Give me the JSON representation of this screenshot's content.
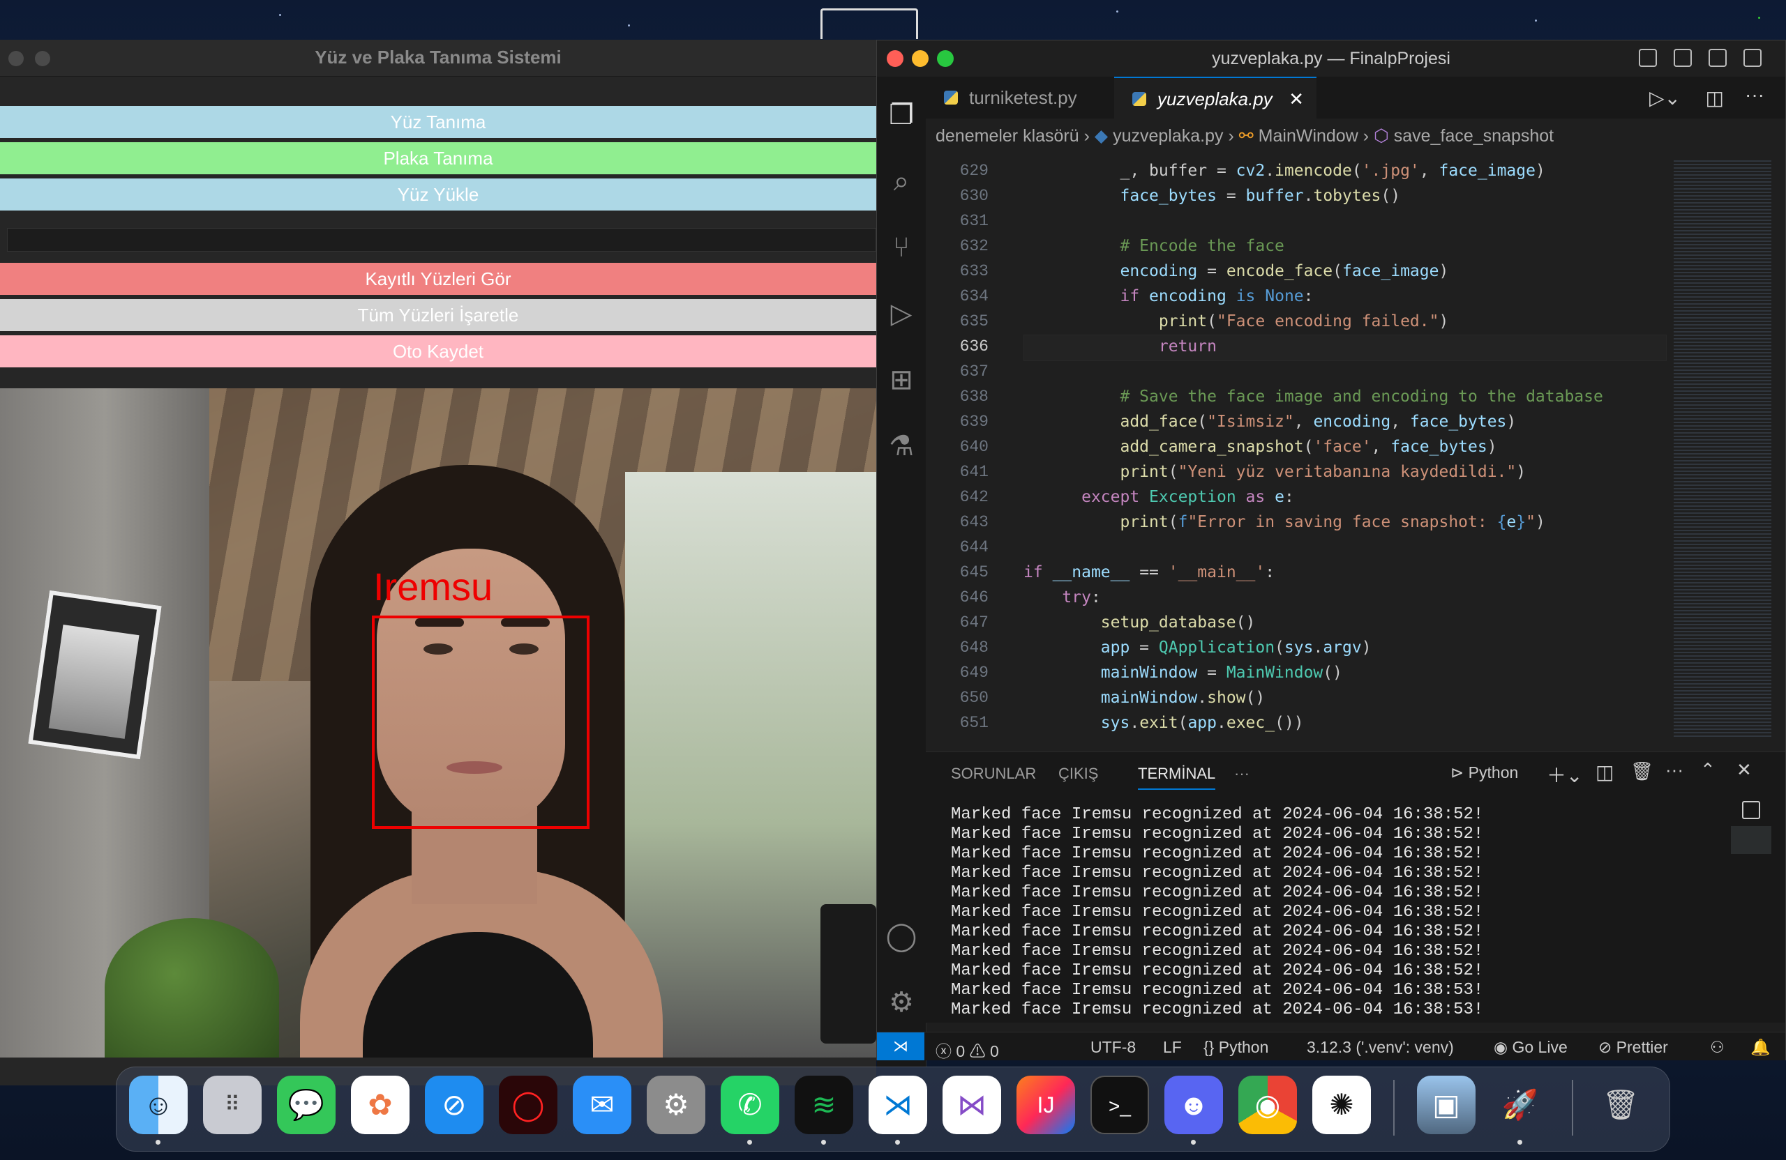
{
  "left_app": {
    "title": "Yüz ve Plaka Tanıma Sistemi",
    "buttons": {
      "face_recognition": "Yüz Tanıma",
      "plate_recognition": "Plaka Tanıma",
      "upload_face": "Yüz Yükle",
      "view_saved": "Kayıtlı Yüzleri Gör",
      "mark_all": "Tüm Yüzleri İşaretle",
      "auto_save": "Oto Kaydet"
    },
    "detected_name": "Iremsu",
    "colors": {
      "blue": "#add8e6",
      "green": "#90ee90",
      "red": "#f08080",
      "gray": "#d3d3d3",
      "pink": "#ffb6c1",
      "box": "#ee0000"
    }
  },
  "vscode": {
    "window_title": "yuzveplaka.py — FinalpProjesi",
    "tabs": [
      "turniketest.py",
      "yuzveplaka.py"
    ],
    "breadcrumb": {
      "folder": "denemeler klasörü",
      "file": "yuzveplaka.py",
      "class": "MainWindow",
      "method": "save_face_snapshot"
    },
    "line_numbers": [
      "629",
      "630",
      "631",
      "632",
      "633",
      "634",
      "635",
      "636",
      "637",
      "638",
      "639",
      "640",
      "641",
      "642",
      "643",
      "644",
      "645",
      "646",
      "647",
      "648",
      "649",
      "650",
      "651"
    ],
    "current_line": "636",
    "panel_tabs": [
      "SORUNLAR",
      "ÇIKIŞ",
      "TERMİNAL",
      "···"
    ],
    "terminal_profile": "Python",
    "terminal_lines": [
      "Marked face Iremsu recognized at 2024-06-04 16:38:52!",
      "Marked face Iremsu recognized at 2024-06-04 16:38:52!",
      "Marked face Iremsu recognized at 2024-06-04 16:38:52!",
      "Marked face Iremsu recognized at 2024-06-04 16:38:52!",
      "Marked face Iremsu recognized at 2024-06-04 16:38:52!",
      "Marked face Iremsu recognized at 2024-06-04 16:38:52!",
      "Marked face Iremsu recognized at 2024-06-04 16:38:52!",
      "Marked face Iremsu recognized at 2024-06-04 16:38:52!",
      "Marked face Iremsu recognized at 2024-06-04 16:38:52!",
      "Marked face Iremsu recognized at 2024-06-04 16:38:53!",
      "Marked face Iremsu recognized at 2024-06-04 16:38:53!"
    ],
    "status": {
      "errors": "0",
      "warnings": "0",
      "encoding": "UTF-8",
      "eol": "LF",
      "language": "Python",
      "interpreter": "3.12.3 ('.venv': venv)",
      "golive": "Go Live",
      "prettier": "Prettier"
    }
  },
  "dock": {
    "apps": [
      "finder-icon",
      "launchpad-icon",
      "messages-icon",
      "photos-icon",
      "safari-icon",
      "opera-icon",
      "mail-icon",
      "system-settings-icon",
      "whatsapp-icon",
      "spotify-icon",
      "vscode-icon",
      "visual-studio-icon",
      "intellij-icon",
      "terminal-icon",
      "discord-icon",
      "chrome-icon",
      "chatgpt-icon",
      "preview-icon",
      "rocket-icon",
      "trash-icon"
    ]
  }
}
